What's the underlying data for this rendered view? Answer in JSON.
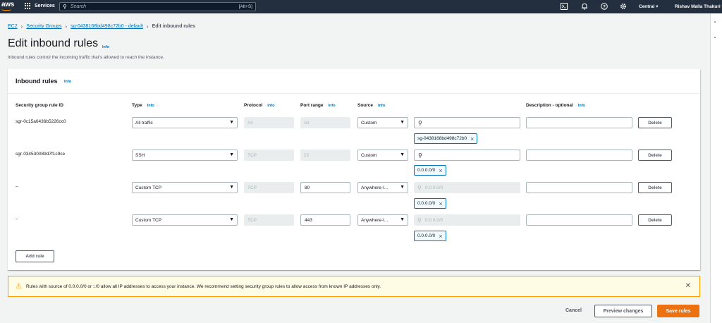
{
  "topnav": {
    "logo": "aws",
    "services_label": "Services",
    "search_placeholder": "Search",
    "search_shortcut": "[Alt+S]",
    "region": "Central ▾",
    "user": "Rishav Malla Thakuri ▾"
  },
  "breadcrumb": {
    "items": [
      "EC2",
      "Security Groups",
      "sg-0438168bd498c72b0 - default"
    ],
    "current": "Edit inbound rules"
  },
  "page": {
    "title": "Edit inbound rules",
    "info": "Info",
    "subtitle": "Inbound rules control the incoming traffic that's allowed to reach the instance."
  },
  "panel": {
    "title": "Inbound rules",
    "info": "Info",
    "columns": {
      "rule_id": "Security group rule ID",
      "type": "Type",
      "protocol": "Protocol",
      "port_range": "Port range",
      "source": "Source",
      "description": "Description - optional",
      "info": "Info"
    },
    "rows": [
      {
        "id": "sgr-0c15a6436b5226cc0",
        "type": "All traffic",
        "protocol": "All",
        "port": "All",
        "source": "Custom",
        "source_search": "",
        "token": "sg-0438168bd498c72b0",
        "description": "",
        "delete": "Delete"
      },
      {
        "id": "sgr-034530089d7f1c9ce",
        "type": "SSH",
        "protocol": "TCP",
        "port": "22",
        "source": "Custom",
        "source_search": "",
        "token": "0.0.0.0/0",
        "description": "",
        "delete": "Delete"
      },
      {
        "id": "–",
        "type": "Custom TCP",
        "protocol": "TCP",
        "port": "80",
        "source": "Anywhere-I...",
        "source_search": "0.0.0.0/0",
        "token": "0.0.0.0/0",
        "description": "",
        "delete": "Delete"
      },
      {
        "id": "–",
        "type": "Custom TCP",
        "protocol": "TCP",
        "port": "443",
        "source": "Anywhere-I...",
        "source_search": "0.0.0.0/0",
        "token": "0.0.0.0/0",
        "description": "",
        "delete": "Delete"
      }
    ],
    "add_rule": "Add rule"
  },
  "warning": {
    "text": "Rules with source of 0.0.0.0/0 or ::/0 allow all IP addresses to access your instance. We recommend setting security group rules to allow access from known IP addresses only."
  },
  "footer": {
    "cancel": "Cancel",
    "preview": "Preview changes",
    "save": "Save rules"
  },
  "colors": {
    "nav_bg": "#232f3e",
    "link": "#0073bb",
    "primary_button": "#ec7211",
    "warning_border": "#ff9900"
  }
}
